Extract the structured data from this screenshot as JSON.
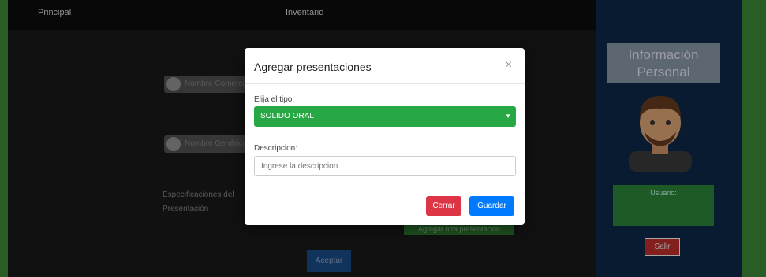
{
  "navbar": {
    "items": [
      {
        "label": "Principal",
        "active": true
      },
      {
        "label": "",
        "active": false
      },
      {
        "label": "",
        "active": false
      },
      {
        "label": "",
        "active": false
      },
      {
        "label": "Inventario",
        "active": true
      },
      {
        "label": "",
        "active": false
      }
    ]
  },
  "background": {
    "row1_label": "Nombre Comercial",
    "row2_label": "Nombre Genérico",
    "specs_label": "Especificaciones del",
    "specs_value": "Presentación",
    "green_button_label": "Agregar otra presentación",
    "accept_button_label": "Aceptar"
  },
  "sidebar": {
    "title": "Información Personal",
    "user_line1": "",
    "user_line2": "Usuario:",
    "user_line3": "",
    "logout_label": "Salir"
  },
  "modal": {
    "title": "Agregar presentaciones",
    "close_symbol": "×",
    "type_label": "Elija el tipo:",
    "type_selected": "SOLIDO ORAL",
    "description_label": "Descripcion:",
    "description_placeholder": "Ingrese la descripcion",
    "cancel_label": "Cerrar",
    "save_label": "Guardar"
  },
  "colors": {
    "select_bg": "#28a745",
    "cancel_bg": "#dc3545",
    "save_bg": "#007bff",
    "sidebar_bg": "#0e2a4a"
  }
}
